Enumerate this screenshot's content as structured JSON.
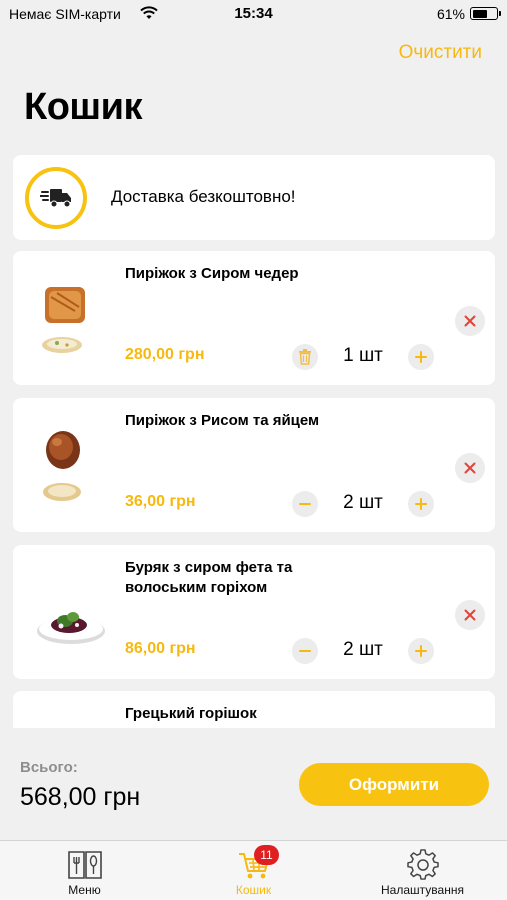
{
  "status_bar": {
    "carrier": "Немає SIM-карти",
    "time": "15:34",
    "battery": "61%"
  },
  "header": {
    "clear_label": "Очистити",
    "title": "Кошик"
  },
  "delivery": {
    "text": "Доставка безкоштовно!",
    "icon": "delivery-truck-icon"
  },
  "cart_items": [
    {
      "name": "Пиріжок з Сиром чедер",
      "price": "280,00 грн",
      "quantity": "1 шт"
    },
    {
      "name": "Пиріжок з Рисом та яйцем",
      "price": "36,00 грн",
      "quantity": "2 шт"
    },
    {
      "name": "Буряк з сиром фета та волоським горіхом",
      "price": "86,00 грн",
      "quantity": "2 шт"
    },
    {
      "name": "Грецький горішок"
    }
  ],
  "summary": {
    "total_label": "Всього:",
    "total_value": "568,00 грн",
    "checkout_label": "Оформити"
  },
  "tabs": [
    {
      "label": "Меню",
      "icon": "menu-book-icon"
    },
    {
      "label": "Кошик",
      "icon": "cart-icon",
      "badge": "11",
      "active": true
    },
    {
      "label": "Налаштування",
      "icon": "gear-icon"
    }
  ],
  "colors": {
    "accent": "#f7b90f",
    "badge": "#e02020",
    "remove": "#e0443a"
  }
}
